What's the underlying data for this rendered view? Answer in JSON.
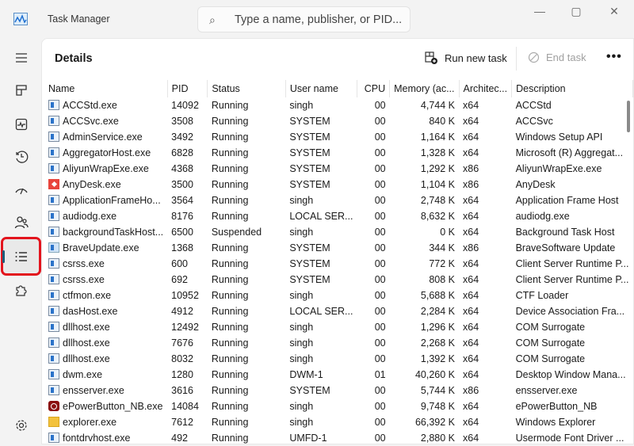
{
  "window": {
    "title": "Task Manager",
    "search_placeholder": "Type a name, publisher, or PID..."
  },
  "sidebar": {
    "items": [
      "menu",
      "processes",
      "performance",
      "app-history",
      "startup-apps",
      "users",
      "details",
      "services"
    ],
    "selected": "details",
    "bottom": "settings"
  },
  "page": {
    "title": "Details",
    "run_new_task": "Run new task",
    "end_task": "End task"
  },
  "columns": [
    "Name",
    "PID",
    "Status",
    "User name",
    "CPU",
    "Memory (ac...",
    "Architec...",
    "Description"
  ],
  "rows": [
    [
      "ACCStd.exe",
      "14092",
      "Running",
      "singh",
      "00",
      "4,744 K",
      "x64",
      "ACCStd",
      "app"
    ],
    [
      "ACCSvc.exe",
      "3508",
      "Running",
      "SYSTEM",
      "00",
      "840 K",
      "x64",
      "ACCSvc",
      "app"
    ],
    [
      "AdminService.exe",
      "3492",
      "Running",
      "SYSTEM",
      "00",
      "1,164 K",
      "x64",
      "Windows Setup API",
      "app"
    ],
    [
      "AggregatorHost.exe",
      "6828",
      "Running",
      "SYSTEM",
      "00",
      "1,328 K",
      "x64",
      "Microsoft (R) Aggregat...",
      "app"
    ],
    [
      "AliyunWrapExe.exe",
      "4368",
      "Running",
      "SYSTEM",
      "00",
      "1,292 K",
      "x86",
      "AliyunWrapExe.exe",
      "app"
    ],
    [
      "AnyDesk.exe",
      "3500",
      "Running",
      "SYSTEM",
      "00",
      "1,104 K",
      "x86",
      "AnyDesk",
      "anydesk"
    ],
    [
      "ApplicationFrameHo...",
      "3564",
      "Running",
      "singh",
      "00",
      "2,748 K",
      "x64",
      "Application Frame Host",
      "app"
    ],
    [
      "audiodg.exe",
      "8176",
      "Running",
      "LOCAL SER...",
      "00",
      "8,632 K",
      "x64",
      "audiodg.exe",
      "app"
    ],
    [
      "backgroundTaskHost...",
      "6500",
      "Suspended",
      "singh",
      "00",
      "0 K",
      "x64",
      "Background Task Host",
      "app"
    ],
    [
      "BraveUpdate.exe",
      "1368",
      "Running",
      "SYSTEM",
      "00",
      "344 K",
      "x86",
      "BraveSoftware Update",
      "brave"
    ],
    [
      "csrss.exe",
      "600",
      "Running",
      "SYSTEM",
      "00",
      "772 K",
      "x64",
      "Client Server Runtime P...",
      "app"
    ],
    [
      "csrss.exe",
      "692",
      "Running",
      "SYSTEM",
      "00",
      "808 K",
      "x64",
      "Client Server Runtime P...",
      "app"
    ],
    [
      "ctfmon.exe",
      "10952",
      "Running",
      "singh",
      "00",
      "5,688 K",
      "x64",
      "CTF Loader",
      "app"
    ],
    [
      "dasHost.exe",
      "4912",
      "Running",
      "LOCAL SER...",
      "00",
      "2,284 K",
      "x64",
      "Device Association Fra...",
      "app"
    ],
    [
      "dllhost.exe",
      "12492",
      "Running",
      "singh",
      "00",
      "1,296 K",
      "x64",
      "COM Surrogate",
      "app"
    ],
    [
      "dllhost.exe",
      "7676",
      "Running",
      "singh",
      "00",
      "2,268 K",
      "x64",
      "COM Surrogate",
      "app"
    ],
    [
      "dllhost.exe",
      "8032",
      "Running",
      "singh",
      "00",
      "1,392 K",
      "x64",
      "COM Surrogate",
      "app"
    ],
    [
      "dwm.exe",
      "1280",
      "Running",
      "DWM-1",
      "01",
      "40,260 K",
      "x64",
      "Desktop Window Mana...",
      "app"
    ],
    [
      "ensserver.exe",
      "3616",
      "Running",
      "SYSTEM",
      "00",
      "5,744 K",
      "x86",
      "ensserver.exe",
      "app"
    ],
    [
      "ePowerButton_NB.exe",
      "14084",
      "Running",
      "singh",
      "00",
      "9,748 K",
      "x64",
      "ePowerButton_NB",
      "power"
    ],
    [
      "explorer.exe",
      "7612",
      "Running",
      "singh",
      "00",
      "66,392 K",
      "x64",
      "Windows Explorer",
      "folder"
    ],
    [
      "fontdrvhost.exe",
      "492",
      "Running",
      "UMFD-1",
      "00",
      "2,880 K",
      "x64",
      "Usermode Font Driver ...",
      "app"
    ]
  ]
}
